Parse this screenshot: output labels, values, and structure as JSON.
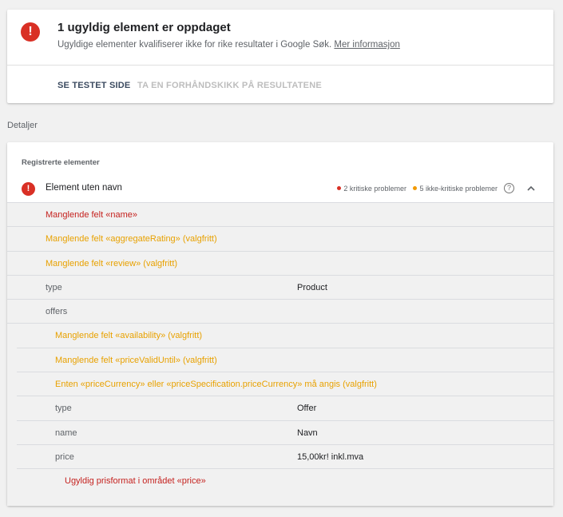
{
  "summary": {
    "title": "1 ugyldig element er oppdaget",
    "subtitle": "Ugyldige elementer kvalifiserer ikke for rike resultater i Google Søk.",
    "link": "Mer informasjon",
    "tabs": [
      "SE TESTET SIDE",
      "TA EN FORHÅNDSKIKK PÅ RESULTATENE"
    ]
  },
  "details_label": "Detaljer",
  "details": {
    "section_title": "Registrerte elementer",
    "item_name": "Element uten navn",
    "critical": "2 kritiske problemer",
    "noncritical": "5 ikke-kritiske problemer",
    "help": "?",
    "rows": [
      {
        "text": "Manglende felt «name»"
      },
      {
        "text": "Manglende felt «aggregateRating» (valgfritt)"
      },
      {
        "text": "Manglende felt «review» (valgfritt)"
      },
      {
        "key": "type",
        "value": "Product"
      },
      {
        "key": "offers"
      },
      {
        "text": "Manglende felt «availability» (valgfritt)"
      },
      {
        "text": "Manglende felt «priceValidUntil» (valgfritt)"
      },
      {
        "text": "Enten «priceCurrency» eller «priceSpecification.priceCurrency» må angis (valgfritt)"
      },
      {
        "key": "type",
        "value": "Offer"
      },
      {
        "key": "name",
        "value": "Navn"
      },
      {
        "key": "price",
        "value": "15,00kr! inkl.mva"
      },
      {
        "text": "Ugyldig prisformat i området «price»"
      }
    ]
  },
  "colors": {
    "critical": "#d93025",
    "warning": "#e8a100",
    "tab_active": "#3c4b60",
    "tab_inactive": "#bdbdbd"
  },
  "icons": {
    "error": "error-icon",
    "help": "help-icon",
    "collapse": "chevron-up-icon"
  }
}
